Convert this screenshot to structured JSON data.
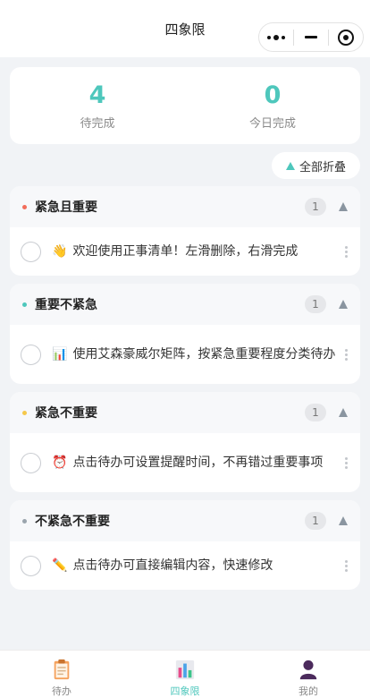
{
  "nav": {
    "title": "四象限"
  },
  "stats": [
    {
      "value": "4",
      "label": "待完成"
    },
    {
      "value": "0",
      "label": "今日完成"
    }
  ],
  "collapse_label": "全部折叠",
  "quadrants": [
    {
      "title": "紧急且重要",
      "dot_color": "#f26d5b",
      "count": "1",
      "todo": {
        "emoji": "👋",
        "text": "欢迎使用正事清单！左滑删除，右滑完成"
      }
    },
    {
      "title": "重要不紧急",
      "dot_color": "#4ec7bc",
      "count": "1",
      "todo": {
        "emoji": "📊",
        "text": "使用艾森豪威尔矩阵，按紧急重要程度分类待办"
      }
    },
    {
      "title": "紧急不重要",
      "dot_color": "#f5c84b",
      "count": "1",
      "todo": {
        "emoji": "⏰",
        "text": "点击待办可设置提醒时间，不再错过重要事项"
      }
    },
    {
      "title": "不紧急不重要",
      "dot_color": "#9aa4ad",
      "count": "1",
      "todo": {
        "emoji": "✏️",
        "text": "点击待办可直接编辑内容，快速修改"
      }
    }
  ],
  "tabbar": [
    {
      "label": "待办",
      "icon": "clipboard-icon",
      "active": false
    },
    {
      "label": "四象限",
      "icon": "bar-chart-icon",
      "active": true
    },
    {
      "label": "我的",
      "icon": "person-icon",
      "active": false
    }
  ],
  "colors": {
    "accent": "#4ec7bc"
  }
}
